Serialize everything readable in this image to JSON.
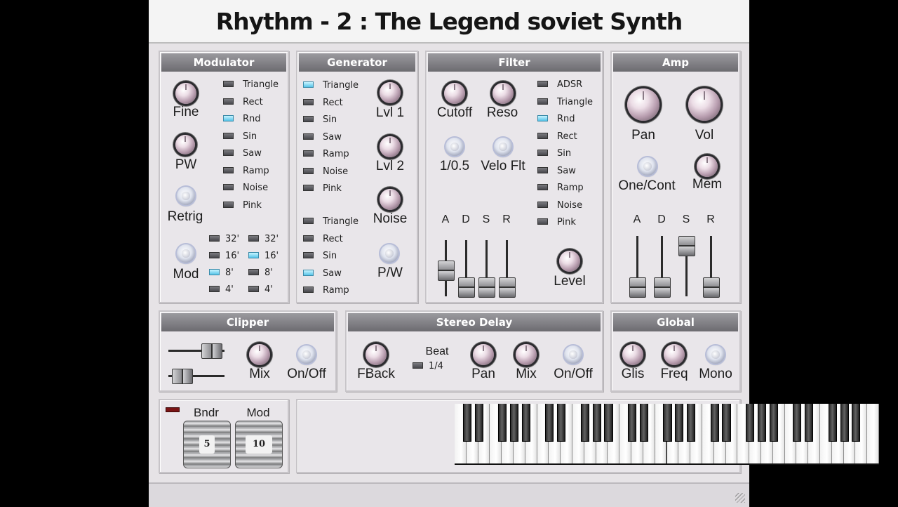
{
  "title": "Rhythm - 2 : The Legend soviet Synth",
  "modulator": {
    "title": "Modulator",
    "knobs": [
      "Fine",
      "PW",
      "Retrig",
      "Mod"
    ],
    "waves": [
      {
        "label": "Triangle",
        "on": false
      },
      {
        "label": "Rect",
        "on": false
      },
      {
        "label": "Rnd",
        "on": true
      },
      {
        "label": "Sin",
        "on": false
      },
      {
        "label": "Saw",
        "on": false
      },
      {
        "label": "Ramp",
        "on": false
      },
      {
        "label": "Noise",
        "on": false
      },
      {
        "label": "Pink",
        "on": false
      }
    ],
    "footage_left": [
      {
        "label": "32'",
        "on": false
      },
      {
        "label": "16'",
        "on": false
      },
      {
        "label": "8'",
        "on": true
      },
      {
        "label": "4'",
        "on": false
      }
    ],
    "footage_right": [
      {
        "label": "32'",
        "on": false
      },
      {
        "label": "16'",
        "on": true
      },
      {
        "label": "8'",
        "on": false
      },
      {
        "label": "4'",
        "on": false
      }
    ]
  },
  "generator": {
    "title": "Generator",
    "osc1": [
      {
        "label": "Triangle",
        "on": true
      },
      {
        "label": "Rect",
        "on": false
      },
      {
        "label": "Sin",
        "on": false
      },
      {
        "label": "Saw",
        "on": false
      },
      {
        "label": "Ramp",
        "on": false
      },
      {
        "label": "Noise",
        "on": false
      },
      {
        "label": "Pink",
        "on": false
      }
    ],
    "osc2": [
      {
        "label": "Triangle",
        "on": false
      },
      {
        "label": "Rect",
        "on": false
      },
      {
        "label": "Sin",
        "on": false
      },
      {
        "label": "Saw",
        "on": true
      },
      {
        "label": "Ramp",
        "on": false
      }
    ],
    "knobs": [
      "Lvl 1",
      "Lvl 2",
      "Noise",
      "P/W"
    ]
  },
  "filter": {
    "title": "Filter",
    "knobs": [
      "Cutoff",
      "Reso",
      "1/0.5",
      "Velo Flt",
      "Level"
    ],
    "modes": [
      {
        "label": "ADSR",
        "on": false
      },
      {
        "label": "Triangle",
        "on": false
      },
      {
        "label": "Rnd",
        "on": true
      },
      {
        "label": "Rect",
        "on": false
      },
      {
        "label": "Sin",
        "on": false
      },
      {
        "label": "Saw",
        "on": false
      },
      {
        "label": "Ramp",
        "on": false
      },
      {
        "label": "Noise",
        "on": false
      },
      {
        "label": "Pink",
        "on": false
      }
    ],
    "adsr": [
      {
        "label": "A",
        "level": 0.45
      },
      {
        "label": "D",
        "level": 0.0
      },
      {
        "label": "S",
        "level": 0.0
      },
      {
        "label": "R",
        "level": 0.0
      }
    ]
  },
  "amp": {
    "title": "Amp",
    "knobs": [
      "Pan",
      "Vol",
      "One/Cont",
      "Mem"
    ],
    "adsr": [
      {
        "label": "A",
        "level": 0.0
      },
      {
        "label": "D",
        "level": 0.0
      },
      {
        "label": "S",
        "level": 1.0
      },
      {
        "label": "R",
        "level": 0.0
      }
    ]
  },
  "clipper": {
    "title": "Clipper",
    "knobs": [
      "Mix",
      "On/Off"
    ],
    "sliders": [
      0.9,
      0.1
    ]
  },
  "delay": {
    "title": "Stereo Delay",
    "knobs": [
      "FBack",
      "Pan",
      "Mix",
      "On/Off"
    ],
    "beat_label": "Beat",
    "beat_value": "1/4"
  },
  "global": {
    "title": "Global",
    "knobs": [
      "Glis",
      "Freq",
      "Mono"
    ]
  },
  "wheels": {
    "bend_label": "Bndr",
    "bend_value": "5",
    "mod_label": "Mod",
    "mod_value": "10"
  },
  "colors": {
    "panel_bg": "#e9e6ea",
    "header_bg": "#6c6b70",
    "led_on": "#56c3e8",
    "led_off": "#47474c"
  }
}
